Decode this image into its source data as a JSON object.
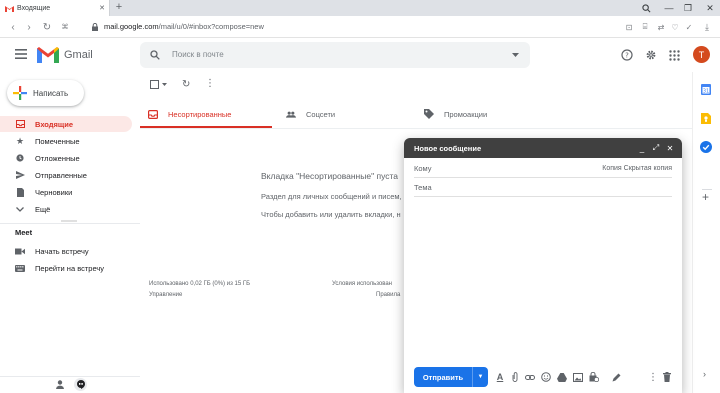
{
  "browser": {
    "tab_title": "Входящие",
    "url_host": "mail.google.com",
    "url_path": "/mail/u/0/#inbox?compose=new"
  },
  "header": {
    "logo_text": "Gmail",
    "search_placeholder": "Поиск в почте",
    "avatar_letter": "Т"
  },
  "colors": {
    "accent": "#d93025",
    "primary": "#1a73e8",
    "compose_header": "#404040"
  },
  "sidebar": {
    "compose_label": "Написать",
    "items": [
      {
        "label": "Входящие",
        "icon": "inbox-icon",
        "active": true
      },
      {
        "label": "Помеченные",
        "icon": "star-icon"
      },
      {
        "label": "Отложенные",
        "icon": "clock-icon"
      },
      {
        "label": "Отправленные",
        "icon": "send-icon"
      },
      {
        "label": "Черновики",
        "icon": "draft-icon"
      },
      {
        "label": "Ещё",
        "icon": "chevron-down-icon"
      }
    ],
    "meet_title": "Meet",
    "meet_items": [
      {
        "label": "Начать встречу",
        "icon": "video-icon"
      },
      {
        "label": "Перейти на встречу",
        "icon": "keyboard-icon"
      }
    ]
  },
  "tabs": [
    {
      "label": "Несортированные",
      "icon": "inbox-icon",
      "active": true
    },
    {
      "label": "Соцсети",
      "icon": "people-icon"
    },
    {
      "label": "Промоакции",
      "icon": "tag-icon"
    }
  ],
  "empty_state": {
    "line1": "Вкладка \"Несортированные\" пуста",
    "line2": "Раздел для личных сообщений и писем,",
    "line3": "Чтобы добавить или удалить вкладки, н"
  },
  "footer": {
    "storage": "Использовано 0,02 ГБ (0%) из 15 ГБ",
    "manage": "Управление",
    "terms": "Условия использован",
    "rules": "Правила"
  },
  "compose": {
    "title": "Новое сообщение",
    "to_label": "Кому",
    "cc_bcc": "Копия Скрытая копия",
    "subject_placeholder": "Тема",
    "send_label": "Отправить"
  }
}
